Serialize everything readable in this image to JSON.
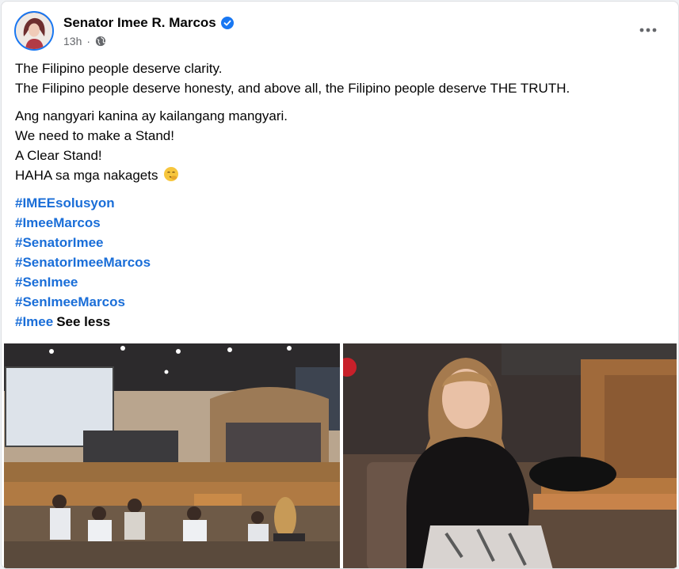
{
  "post": {
    "author": "Senator Imee R. Marcos",
    "time": "13h",
    "separator": "·",
    "paragraphs": [
      [
        "The Filipino people deserve clarity.",
        "The Filipino people deserve honesty, and above all, the Filipino people deserve THE TRUTH."
      ],
      [
        "Ang nangyari kanina ay kailangang mangyari.",
        "We need to make a Stand!",
        "A Clear Stand!",
        "HAHA sa mga nakagets"
      ]
    ],
    "emoji": "face-with-hand-over-mouth-emoji",
    "hashtags": [
      "#IMEEsolusyon",
      "#ImeeMarcos",
      "#SenatorImee",
      "#SenatorImeeMarcos",
      "#SenImee",
      "#SenImeeMarcos",
      "#Imee"
    ],
    "see_less": "See less"
  },
  "colors": {
    "hashtag": "#1a6ed8",
    "verified": "#1877f2",
    "meta": "#65676b",
    "text": "#050505"
  },
  "icons": {
    "verified": "verified-badge-icon",
    "privacy": "globe-icon",
    "more": "more-options-icon"
  }
}
